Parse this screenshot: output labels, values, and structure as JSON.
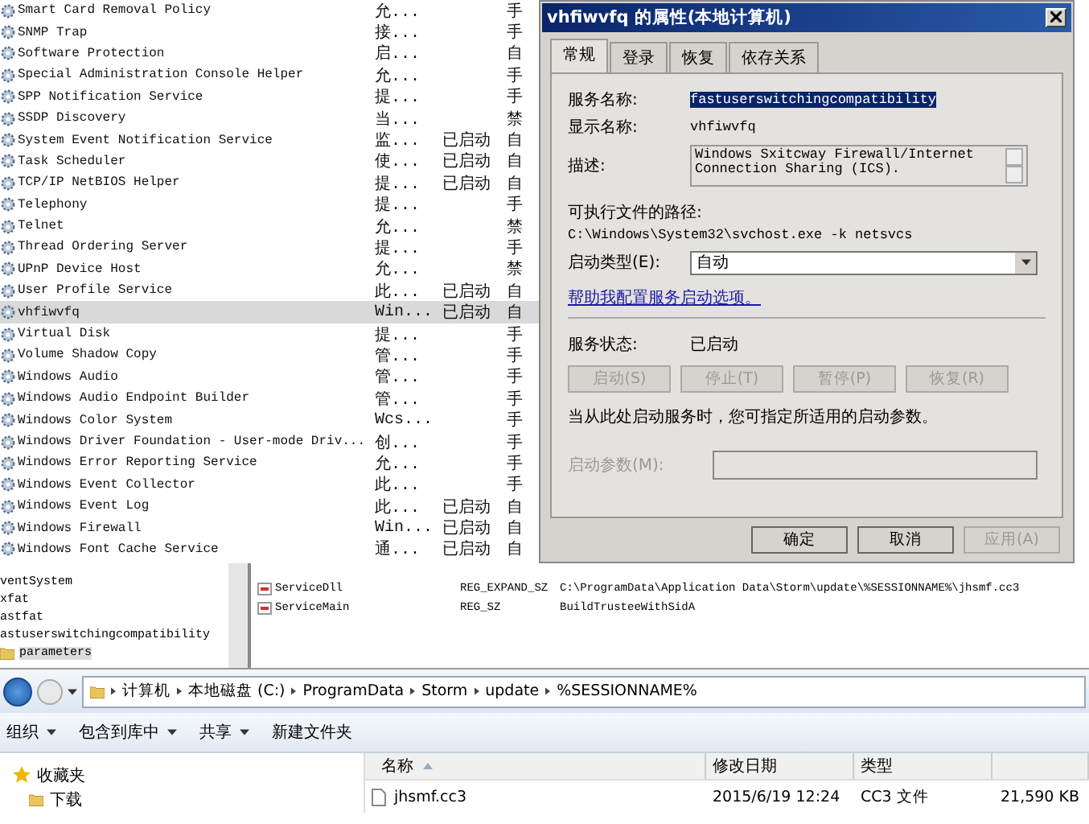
{
  "services": {
    "rows": [
      {
        "name": "Smart Card Removal Policy",
        "description": "允...",
        "status": "",
        "startup": "手",
        "selected": false
      },
      {
        "name": "SNMP Trap",
        "description": "接...",
        "status": "",
        "startup": "手",
        "selected": false
      },
      {
        "name": "Software Protection",
        "description": "启...",
        "status": "",
        "startup": "自",
        "selected": false
      },
      {
        "name": "Special Administration Console Helper",
        "description": "允...",
        "status": "",
        "startup": "手",
        "selected": false
      },
      {
        "name": "SPP Notification Service",
        "description": "提...",
        "status": "",
        "startup": "手",
        "selected": false
      },
      {
        "name": "SSDP Discovery",
        "description": "当...",
        "status": "",
        "startup": "禁",
        "selected": false
      },
      {
        "name": "System Event Notification Service",
        "description": "监...",
        "status": "已启动",
        "startup": "自",
        "selected": false
      },
      {
        "name": "Task Scheduler",
        "description": "使...",
        "status": "已启动",
        "startup": "自",
        "selected": false
      },
      {
        "name": "TCP/IP NetBIOS Helper",
        "description": "提...",
        "status": "已启动",
        "startup": "自",
        "selected": false
      },
      {
        "name": "Telephony",
        "description": "提...",
        "status": "",
        "startup": "手",
        "selected": false
      },
      {
        "name": "Telnet",
        "description": "允...",
        "status": "",
        "startup": "禁",
        "selected": false
      },
      {
        "name": "Thread Ordering Server",
        "description": "提...",
        "status": "",
        "startup": "手",
        "selected": false
      },
      {
        "name": "UPnP Device Host",
        "description": "允...",
        "status": "",
        "startup": "禁",
        "selected": false
      },
      {
        "name": "User Profile Service",
        "description": "此...",
        "status": "已启动",
        "startup": "自",
        "selected": false
      },
      {
        "name": "vhfiwvfq",
        "description": "Win...",
        "status": "已启动",
        "startup": "自",
        "selected": true
      },
      {
        "name": "Virtual Disk",
        "description": "提...",
        "status": "",
        "startup": "手",
        "selected": false
      },
      {
        "name": "Volume Shadow Copy",
        "description": "管...",
        "status": "",
        "startup": "手",
        "selected": false
      },
      {
        "name": "Windows Audio",
        "description": "管...",
        "status": "",
        "startup": "手",
        "selected": false
      },
      {
        "name": "Windows Audio Endpoint Builder",
        "description": "管...",
        "status": "",
        "startup": "手",
        "selected": false
      },
      {
        "name": "Windows Color System",
        "description": "Wcs...",
        "status": "",
        "startup": "手",
        "selected": false
      },
      {
        "name": "Windows Driver Foundation - User-mode Driv...",
        "description": "创...",
        "status": "",
        "startup": "手",
        "selected": false
      },
      {
        "name": "Windows Error Reporting Service",
        "description": "允...",
        "status": "",
        "startup": "手",
        "selected": false
      },
      {
        "name": "Windows Event Collector",
        "description": "此...",
        "status": "",
        "startup": "手",
        "selected": false
      },
      {
        "name": "Windows Event Log",
        "description": "此...",
        "status": "已启动",
        "startup": "自",
        "selected": false
      },
      {
        "name": "Windows Firewall",
        "description": "Win...",
        "status": "已启动",
        "startup": "自",
        "selected": false
      },
      {
        "name": "Windows Font Cache Service",
        "description": "通...",
        "status": "已启动",
        "startup": "自",
        "selected": false
      }
    ]
  },
  "dialog": {
    "title": "vhfiwvfq 的属性(本地计算机)",
    "tabs": [
      {
        "label": "常规",
        "selected": true
      },
      {
        "label": "登录",
        "selected": false
      },
      {
        "label": "恢复",
        "selected": false
      },
      {
        "label": "依存关系",
        "selected": false
      }
    ],
    "service_name": {
      "label": "服务名称:",
      "value": "fastuserswitchingcompatibility",
      "highlighted": true
    },
    "display_name": {
      "label": "显示名称:",
      "value": "vhfiwvfq"
    },
    "description": {
      "label": "描述:",
      "value": "Windows Sxitcway Firewall/Internet Connection Sharing (ICS)."
    },
    "executable_path": {
      "label": "可执行文件的路径:",
      "value": "C:\\Windows\\System32\\svchost.exe -k netsvcs"
    },
    "startup_type": {
      "label": "启动类型(E):",
      "value": "自动"
    },
    "help_link": "帮助我配置服务启动选项。",
    "service_status": {
      "label": "服务状态:",
      "value": "已启动"
    },
    "control_buttons": [
      {
        "label": "启动(S)",
        "disabled": true
      },
      {
        "label": "停止(T)",
        "disabled": true
      },
      {
        "label": "暂停(P)",
        "disabled": true
      },
      {
        "label": "恢复(R)",
        "disabled": true
      }
    ],
    "hint": "当从此处启动服务时，您可指定所适用的启动参数。",
    "start_parameters": {
      "label": "启动参数(M):",
      "disabled": true
    },
    "footer_buttons": [
      {
        "label": "确定",
        "disabled": false
      },
      {
        "label": "取消",
        "disabled": false
      },
      {
        "label": "应用(A)",
        "disabled": true
      }
    ]
  },
  "registry": {
    "tree": [
      {
        "label": "ventSystem",
        "selected": false
      },
      {
        "label": "xfat",
        "selected": false
      },
      {
        "label": "astfat",
        "selected": false
      },
      {
        "label": "astuserswitchingcompatibility",
        "selected": false,
        "children": [
          {
            "label": "parameters",
            "selected": true
          }
        ]
      }
    ],
    "values": [
      {
        "name": "ServiceDll",
        "type": "REG_EXPAND_SZ",
        "data": "C:\\ProgramData\\Application Data\\Storm\\update\\%SESSIONNAME%\\jhsmf.cc3"
      },
      {
        "name": "ServiceMain",
        "type": "REG_SZ",
        "data": "BuildTrusteeWithSidA"
      }
    ]
  },
  "explorer": {
    "path": [
      "计算机",
      "本地磁盘 (C:)",
      "ProgramData",
      "Storm",
      "update",
      "%SESSIONNAME%"
    ],
    "toolbar": [
      {
        "label": "组织",
        "dropdown": true
      },
      {
        "label": "包含到库中",
        "dropdown": true
      },
      {
        "label": "共享",
        "dropdown": true
      },
      {
        "label": "新建文件夹",
        "dropdown": false
      }
    ],
    "nav": [
      {
        "label": "收藏夹",
        "kind": "favorites"
      },
      {
        "label": "下载",
        "kind": "folder"
      }
    ],
    "columns": [
      "名称",
      "修改日期",
      "类型"
    ],
    "files": [
      {
        "name": "jhsmf.cc3",
        "modified": "2015/6/19 12:24",
        "type": "CC3 文件",
        "size": "21,590 KB"
      }
    ]
  }
}
